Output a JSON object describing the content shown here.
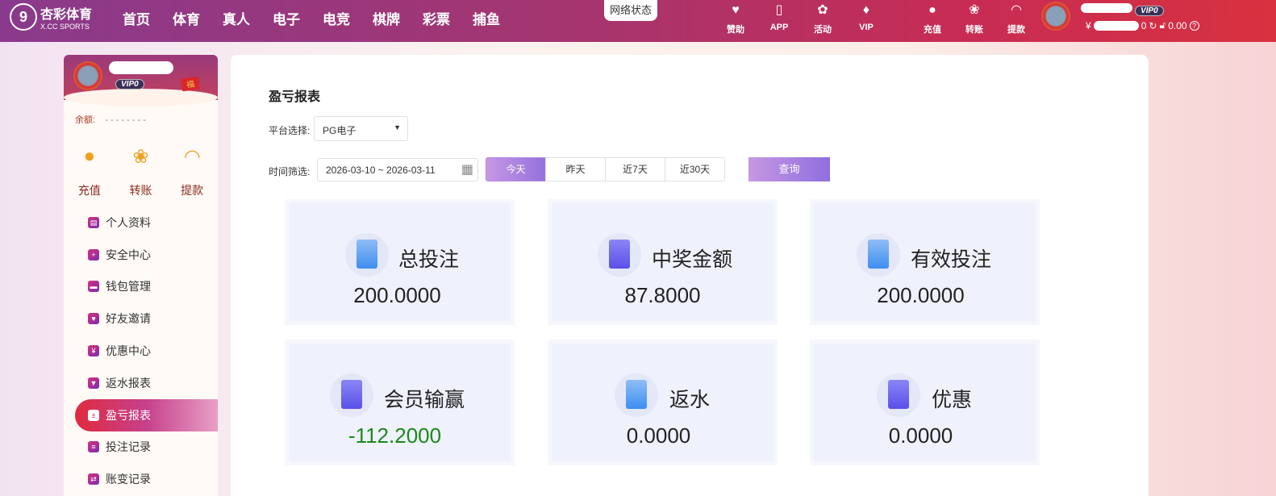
{
  "header": {
    "logo_title": "杏彩体育",
    "logo_sub": "X.CC SPORTS",
    "nav": [
      "首页",
      "体育",
      "真人",
      "电子",
      "电竞",
      "棋牌",
      "彩票",
      "捕鱼"
    ],
    "network_status": "网络状态",
    "links": [
      "赞助",
      "APP",
      "活动",
      "VIP"
    ],
    "actions": [
      "充值",
      "转账",
      "提款"
    ],
    "vip": "VIP0",
    "balance_prefix": "¥",
    "balance_suffix": "0",
    "locked": "0.00"
  },
  "sidebar": {
    "vip": "VIP0",
    "balance_label": "余额:",
    "balance_value": "- - - - - - - -",
    "actions": [
      "充值",
      "转账",
      "提款"
    ],
    "menu": [
      "个人资料",
      "安全中心",
      "钱包管理",
      "好友邀请",
      "优惠中心",
      "返水报表",
      "盈亏报表",
      "投注记录",
      "账变记录"
    ]
  },
  "main": {
    "title": "盈亏报表",
    "platform_label": "平台选择:",
    "platform_value": "PG电子",
    "time_label": "时间筛选:",
    "date_range": "2026-03-10 ~ 2026-03-11",
    "quick": [
      "今天",
      "昨天",
      "近7天",
      "近30天"
    ],
    "search": "查询",
    "cards": [
      {
        "name": "总投注",
        "value": "200.0000"
      },
      {
        "name": "中奖金额",
        "value": "87.8000"
      },
      {
        "name": "有效投注",
        "value": "200.0000"
      },
      {
        "name": "会员输赢",
        "value": "-112.2000",
        "color": "#1a8a1a"
      },
      {
        "name": "返水",
        "value": "0.0000"
      },
      {
        "name": "优惠",
        "value": "0.0000"
      }
    ]
  }
}
